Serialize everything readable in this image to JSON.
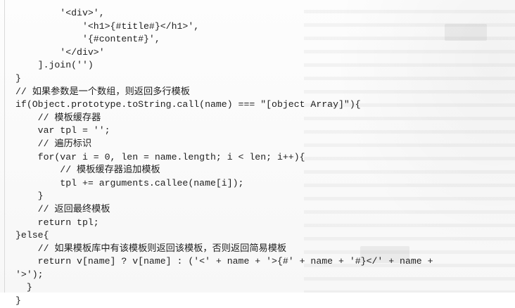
{
  "code_lines": [
    "        '<div>',",
    "            '<h1>{#title#}</h1>',",
    "            '{#content#}',",
    "        '</div>'",
    "    ].join('')",
    "}",
    "// 如果参数是一个数组，则返回多行模板",
    "if(Object.prototype.toString.call(name) === \"[object Array]\"){",
    "    // 模板缓存器",
    "    var tpl = '';",
    "    // 遍历标识",
    "    for(var i = 0, len = name.length; i < len; i++){",
    "        // 模板缓存器追加模板",
    "        tpl += arguments.callee(name[i]);",
    "    }",
    "    // 返回最终模板",
    "    return tpl;",
    "}else{",
    "    // 如果模板库中有该模板则返回该模板，否则返回简易模板",
    "    return v[name] ? v[name] : ('<' + name + '>{#' + name + '#}</' + name +",
    "'>');",
    "  }",
    "}"
  ]
}
